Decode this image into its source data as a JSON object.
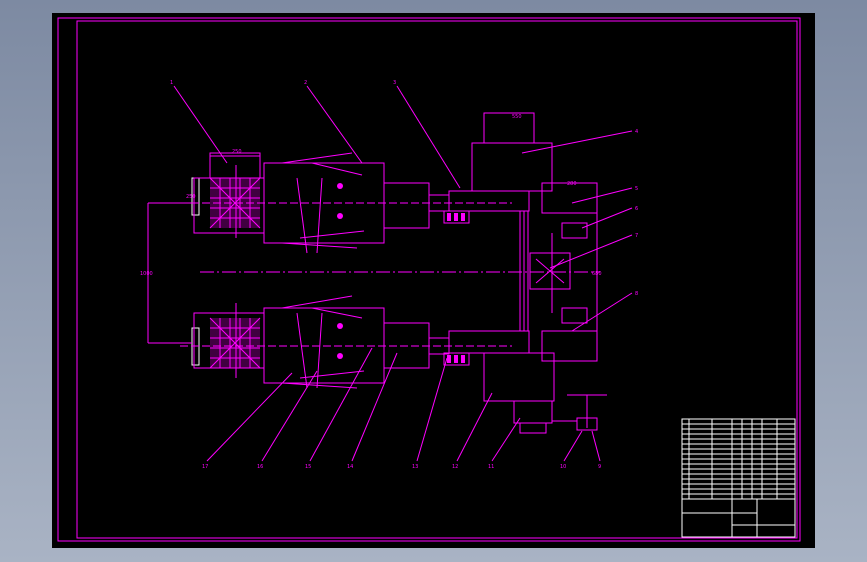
{
  "colors": {
    "background": "#000000",
    "lines": "#ff00ff",
    "table_text": "#ffffff",
    "desktop_top": "#7d8aa2",
    "desktop_bottom": "#a9b3c4"
  },
  "drawing": {
    "part_numbers_top": [
      "1",
      "2",
      "3"
    ],
    "part_numbers_right": [
      "4",
      "5",
      "6",
      "7",
      "8"
    ],
    "part_numbers_bottom": [
      "17",
      "16",
      "15",
      "14",
      "13",
      "12",
      "11",
      "10",
      "9"
    ],
    "dimension_labels": [
      "250",
      "250",
      "280",
      "1000",
      "680",
      "550"
    ]
  },
  "title_block": {
    "drawing_title": "",
    "drawing_number": "",
    "scale": ""
  }
}
